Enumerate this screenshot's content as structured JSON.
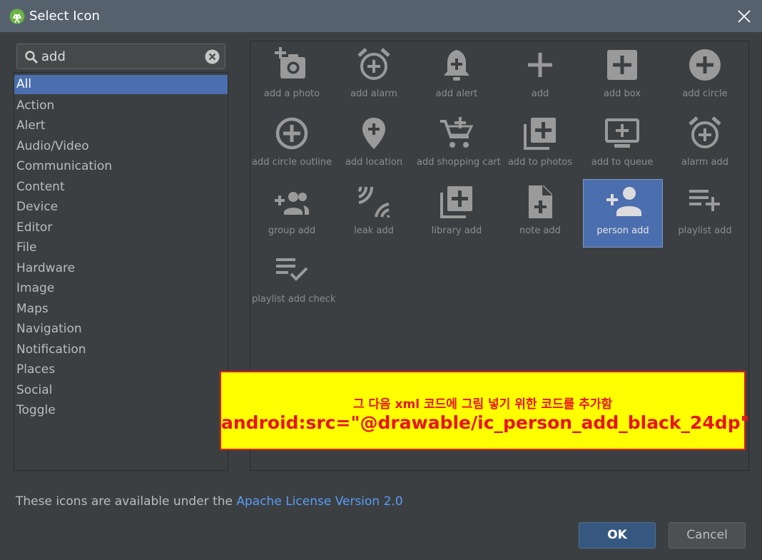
{
  "window": {
    "title": "Select Icon",
    "logo_icon": "android-studio-icon",
    "close_icon": "close-icon"
  },
  "search": {
    "value": "add",
    "icon": "search-icon",
    "clear_icon": "clear-icon"
  },
  "categories": {
    "selected": "All",
    "items": [
      "All",
      "Action",
      "Alert",
      "Audio/Video",
      "Communication",
      "Content",
      "Device",
      "Editor",
      "File",
      "Hardware",
      "Image",
      "Maps",
      "Navigation",
      "Notification",
      "Places",
      "Social",
      "Toggle"
    ]
  },
  "icons": {
    "selected": "person add",
    "items": [
      "add a photo",
      "add alarm",
      "add alert",
      "add",
      "add box",
      "add circle",
      "add circle outline",
      "add location",
      "add shopping cart",
      "add to photos",
      "add to queue",
      "alarm add",
      "group add",
      "leak add",
      "library add",
      "note add",
      "person add",
      "playlist add",
      "playlist add check"
    ]
  },
  "annotation": {
    "line1": "그 다음 xml 코드에 그림 넣기 위한 코드를 추가함",
    "line2": "android:src=\"@drawable/ic_person_add_black_24dp\"",
    "background": "#ffff00",
    "text_color": "#e8141b"
  },
  "footer": {
    "license_text": "These icons are available under the ",
    "license_link": "Apache License Version 2.0"
  },
  "buttons": {
    "ok": "OK",
    "cancel": "Cancel"
  },
  "colors": {
    "selection": "#4b6eaf",
    "link": "#589df6",
    "ok_button": "#365880"
  }
}
